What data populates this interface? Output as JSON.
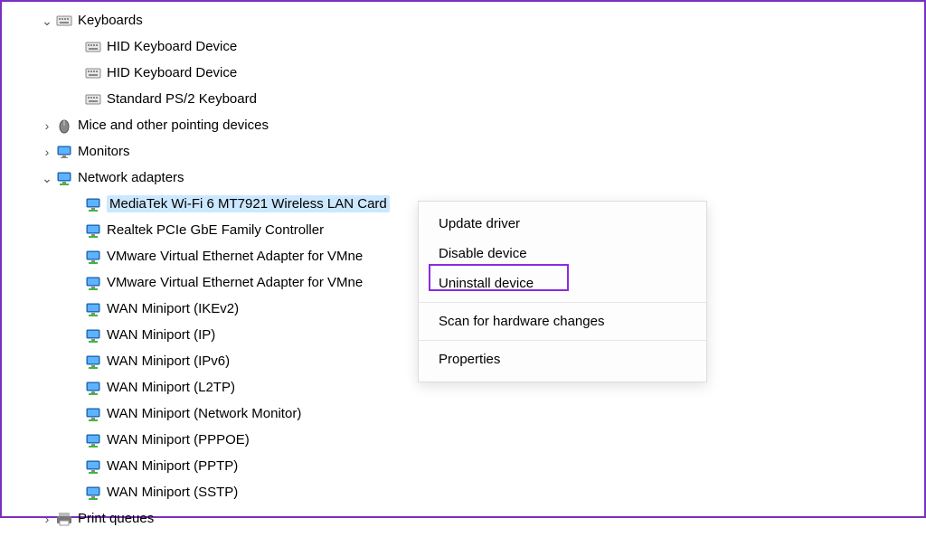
{
  "tree": {
    "keyboards": {
      "label": "Keyboards",
      "children": [
        {
          "label": "HID Keyboard Device"
        },
        {
          "label": "HID Keyboard Device"
        },
        {
          "label": "Standard PS/2 Keyboard"
        }
      ]
    },
    "mice": {
      "label": "Mice and other pointing devices"
    },
    "monitors": {
      "label": "Monitors"
    },
    "network": {
      "label": "Network adapters",
      "children": [
        {
          "label": "MediaTek Wi-Fi 6 MT7921 Wireless LAN Card"
        },
        {
          "label": "Realtek PCIe GbE Family Controller"
        },
        {
          "label": "VMware Virtual Ethernet Adapter for VMne"
        },
        {
          "label": "VMware Virtual Ethernet Adapter for VMne"
        },
        {
          "label": "WAN Miniport (IKEv2)"
        },
        {
          "label": "WAN Miniport (IP)"
        },
        {
          "label": "WAN Miniport (IPv6)"
        },
        {
          "label": "WAN Miniport (L2TP)"
        },
        {
          "label": "WAN Miniport (Network Monitor)"
        },
        {
          "label": "WAN Miniport (PPPOE)"
        },
        {
          "label": "WAN Miniport (PPTP)"
        },
        {
          "label": "WAN Miniport (SSTP)"
        }
      ]
    },
    "printqueues": {
      "label": "Print queues"
    }
  },
  "context_menu": {
    "update": "Update driver",
    "disable": "Disable device",
    "uninstall": "Uninstall device",
    "scan": "Scan for hardware changes",
    "properties": "Properties"
  }
}
